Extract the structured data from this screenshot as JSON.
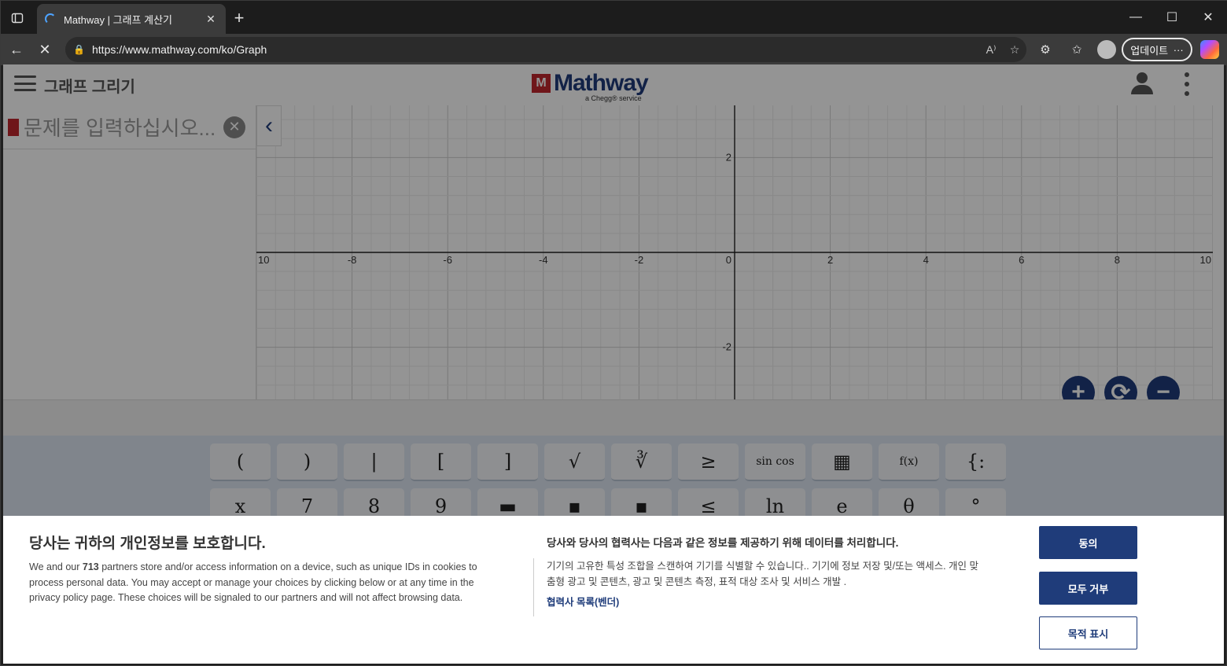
{
  "browser": {
    "tab_title": "Mathway | 그래프 계산기",
    "url": "https://www.mathway.com/ko/Graph",
    "update_label": "업데이트",
    "more_label": "···",
    "read_aloud_label": "A⁾"
  },
  "app": {
    "page_title": "그래프 그리기",
    "logo_mark": "M",
    "logo_word": "Mathway",
    "logo_sub": "a Chegg® service",
    "input_placeholder": "문제를 입력하십시오...",
    "clear_glyph": "✕",
    "collapse_glyph": "‹"
  },
  "graph": {
    "x_ticks": [
      "10",
      "-8",
      "-6",
      "-4",
      "-2",
      "0",
      "2",
      "4",
      "6",
      "8",
      "10"
    ],
    "y_ticks": [
      "2",
      "-2"
    ],
    "x_range": [
      -10,
      10
    ],
    "y_range": [
      -3.1,
      3.1
    ],
    "zoom_in": "+",
    "reset": "⟳",
    "zoom_out": "−"
  },
  "keypad": {
    "row1": [
      "(",
      ")",
      "|",
      "[",
      "]",
      "√",
      "∛",
      "≥",
      "sin cos",
      "▦",
      "f(x)",
      "{:"
    ],
    "row2": [
      "x",
      "7",
      "8",
      "9",
      "▬",
      "▪",
      "▪",
      "≤",
      "ln",
      "e",
      "θ",
      "°"
    ]
  },
  "consent": {
    "title": "당사는 귀하의 개인정보를 보호합니다.",
    "body_pre": "We and our ",
    "partners_count": "713",
    "body_post": " partners store and/or access information on a device, such as unique IDs in cookies to process personal data. You may accept or manage your choices by clicking below or at any time in the privacy policy page. These choices will be signaled to our partners and will not affect browsing data.",
    "purposes_title": "당사와 당사의 협력사는 다음과 같은 정보를 제공하기 위해 데이터를 처리합니다.",
    "purposes_body": "기기의 고유한 특성 조합을 스캔하여 기기를 식별할 수 있습니다.. 기기에 정보 저장 및/또는 액세스. 개인 맞춤형 광고 및 콘텐츠, 광고 및 콘텐츠 측정, 표적 대상 조사 및 서비스 개발 .",
    "vendors_link": "협력사 목록(벤더)",
    "accept": "동의",
    "reject_all": "모두 거부",
    "show_purposes": "목적 표시"
  },
  "colors": {
    "brand_blue": "#1f3c7a",
    "brand_red": "#c0272d"
  }
}
